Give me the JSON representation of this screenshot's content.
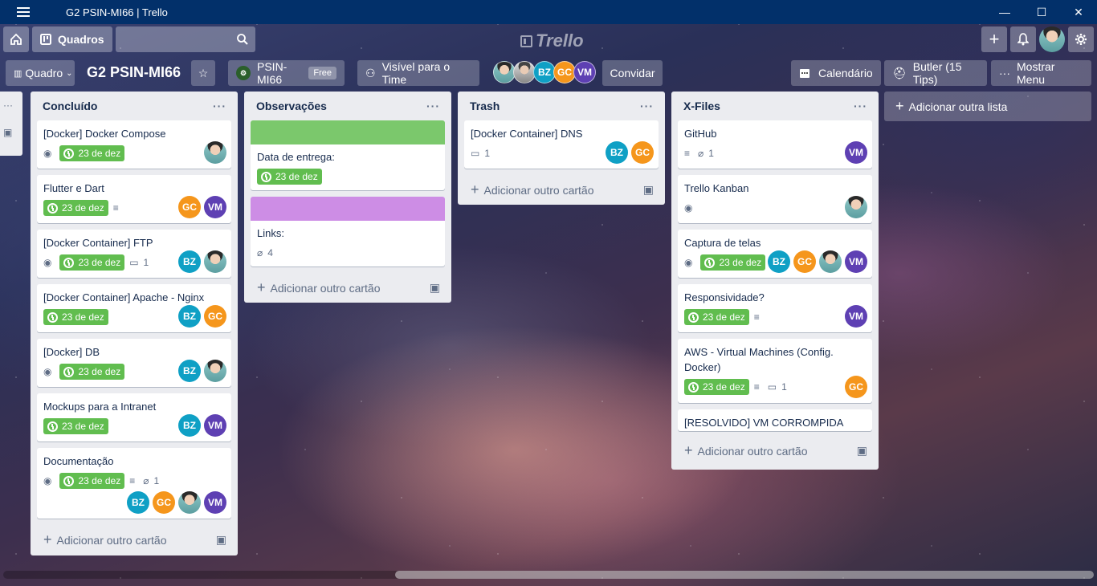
{
  "window": {
    "title": "G2 PSIN-MI66 | Trello",
    "minimize": "—",
    "maximize": "☐",
    "close": "✕"
  },
  "appbar": {
    "quadros_label": "Quadros",
    "logo": "Trello"
  },
  "board": {
    "view_label": "Quadro",
    "title": "G2 PSIN-MI66",
    "team_name": "PSIN-MI66",
    "plan": "Free",
    "visibility": "Visível para o Time",
    "invite": "Convidar",
    "calendar": "Calendário",
    "butler": "Butler (15 Tips)",
    "menu": "Mostrar Menu",
    "members": [
      "BZ",
      "GC",
      "VM"
    ]
  },
  "lists": {
    "concluido": {
      "title": "Concluído",
      "add_card": "Adicionar outro cartão",
      "cards": [
        {
          "title": "[Docker] Docker Compose",
          "due": "23 de dez"
        },
        {
          "title": "Flutter e Dart",
          "due": "23 de dez",
          "members": [
            "GC",
            "VM"
          ]
        },
        {
          "title": "[Docker Container] FTP",
          "due": "23 de dez",
          "comments": "1",
          "members": [
            "BZ"
          ]
        },
        {
          "title": "[Docker Container] Apache - Nginx",
          "due": "23 de dez",
          "members": [
            "BZ",
            "GC"
          ]
        },
        {
          "title": "[Docker] DB",
          "due": "23 de dez",
          "members": [
            "BZ"
          ]
        },
        {
          "title": "Mockups para a Intranet",
          "due": "23 de dez",
          "members": [
            "BZ",
            "VM"
          ]
        },
        {
          "title": "Documentação",
          "due": "23 de dez",
          "attachments": "1",
          "members": [
            "BZ",
            "GC",
            "VM"
          ]
        }
      ]
    },
    "observacoes": {
      "title": "Observações",
      "add_card": "Adicionar outro cartão",
      "cards": [
        {
          "title": "Data de entrega:",
          "due": "23 de dez",
          "cover": "#7bc86c"
        },
        {
          "title": "Links:",
          "attachments": "4",
          "cover": "#cd8de5"
        }
      ]
    },
    "trash": {
      "title": "Trash",
      "add_card": "Adicionar outro cartão",
      "cards": [
        {
          "title": "[Docker Container] DNS",
          "comments": "1",
          "members": [
            "BZ",
            "GC"
          ]
        }
      ]
    },
    "xfiles": {
      "title": "X-Files",
      "add_card": "Adicionar outro cartão",
      "cards": [
        {
          "title": "GitHub",
          "attachments": "1",
          "members": [
            "VM"
          ]
        },
        {
          "title": "Trello Kanban"
        },
        {
          "title": "Captura de telas",
          "due": "23 de dez",
          "members": [
            "BZ",
            "GC",
            "VM"
          ]
        },
        {
          "title": "Responsividade?",
          "due": "23 de dez",
          "members": [
            "VM"
          ]
        },
        {
          "title": "AWS - Virtual Machines (Config. Docker)",
          "due": "23 de dez",
          "comments": "1",
          "members": [
            "GC"
          ]
        },
        {
          "title": "[RESOLVIDO] VM CORROMPIDA"
        }
      ]
    }
  },
  "add_list": "Adicionar outra lista",
  "colors": {
    "titlebar": "#02306a",
    "due_green": "#61bd4f",
    "list_bg": "#ebecf0",
    "bz": "#0fa0c5",
    "gc": "#f5961c",
    "vm": "#5e40b3"
  }
}
